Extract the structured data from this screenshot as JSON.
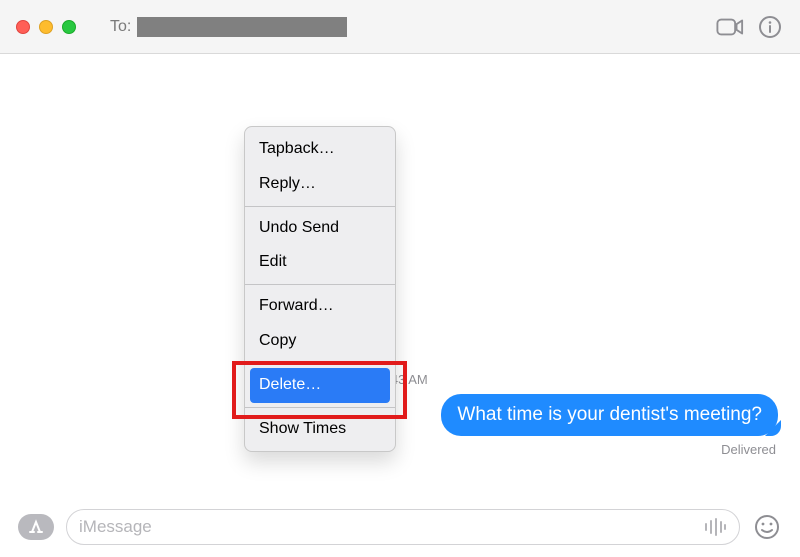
{
  "header": {
    "to_label": "To:"
  },
  "conversation": {
    "timestamp": "1:43 AM",
    "message_text": "What time is your dentist's meeting?",
    "delivered_label": "Delivered"
  },
  "context_menu": {
    "items": [
      {
        "label": "Tapback…",
        "highlighted": false
      },
      {
        "label": "Reply…",
        "highlighted": false
      }
    ],
    "group2": [
      {
        "label": "Undo Send",
        "highlighted": false
      },
      {
        "label": "Edit",
        "highlighted": false
      }
    ],
    "group3": [
      {
        "label": "Forward…",
        "highlighted": false
      },
      {
        "label": "Copy",
        "highlighted": false
      }
    ],
    "group4": [
      {
        "label": "Delete…",
        "highlighted": true
      }
    ],
    "group5": [
      {
        "label": "Show Times",
        "highlighted": false
      }
    ]
  },
  "compose": {
    "placeholder": "iMessage"
  }
}
